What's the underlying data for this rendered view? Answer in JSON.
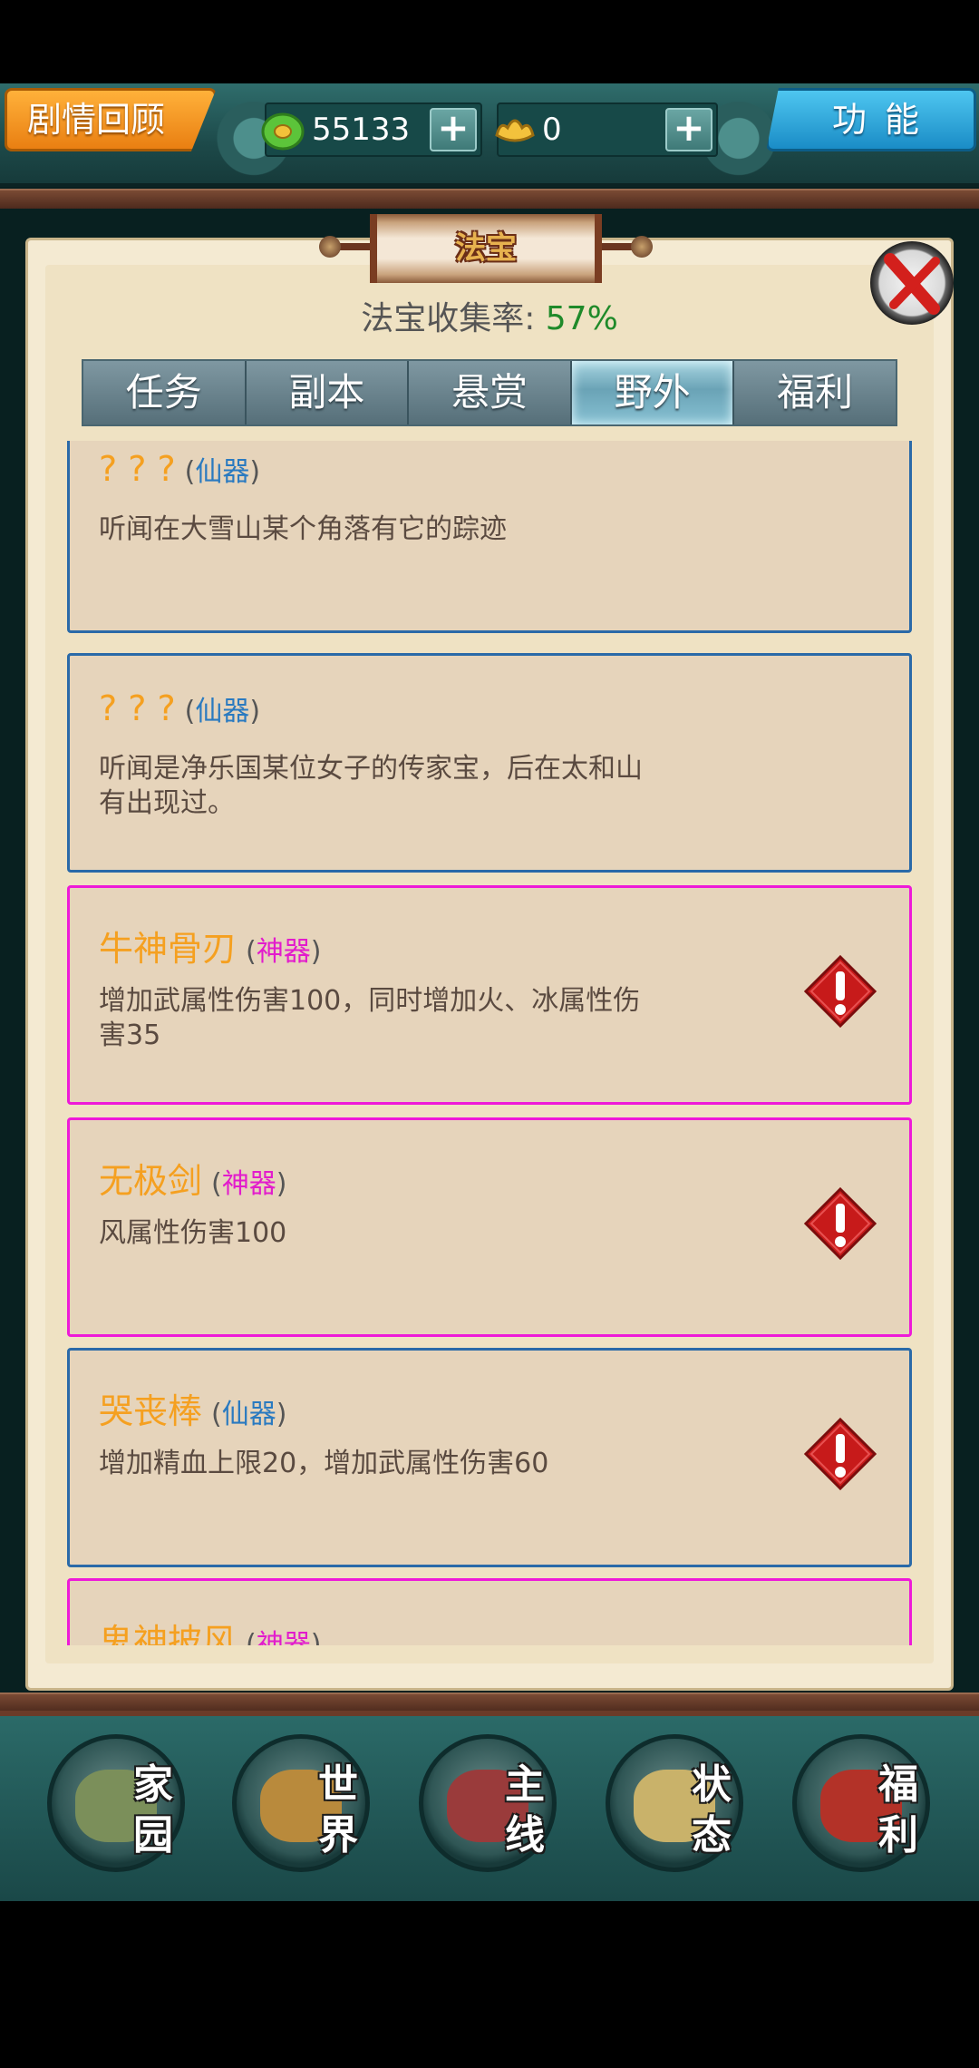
{
  "header": {
    "story_button": "剧情回顾",
    "jade_amount": "55133",
    "gold_amount": "0",
    "plus_label": "+",
    "function_button": "功能"
  },
  "panel": {
    "title": "法宝",
    "collect_label": "法宝收集率: ",
    "collect_value": "57%"
  },
  "tabs": [
    {
      "label": "任务"
    },
    {
      "label": "副本"
    },
    {
      "label": "悬赏"
    },
    {
      "label": "野外",
      "active": true
    },
    {
      "label": "福利"
    }
  ],
  "type_open": "(",
  "type_close": ")",
  "items": [
    {
      "name": "? ? ?",
      "type": "仙器",
      "desc": "听闻在大雪山某个角落有它的踪迹",
      "alert": false
    },
    {
      "name": "? ? ?",
      "type": "仙器",
      "desc": "听闻是净乐国某位女子的传家宝，后在太和山有出现过。",
      "alert": false
    },
    {
      "name": "牛神骨刃",
      "type": "神器",
      "desc": "增加武属性伤害100，同时增加火、冰属性伤害35",
      "alert": true
    },
    {
      "name": "无极剑",
      "type": "神器",
      "desc": "风属性伤害100",
      "alert": true
    },
    {
      "name": "哭丧棒",
      "type": "仙器",
      "desc": "增加精血上限20，增加武属性伤害60",
      "alert": true
    },
    {
      "name": "鬼神披风",
      "type": "神器",
      "desc": "",
      "alert": false
    }
  ],
  "nav": [
    {
      "l1": "家",
      "l2": "园",
      "color": "#7b8f5a"
    },
    {
      "l1": "世",
      "l2": "界",
      "color": "#b98a3c"
    },
    {
      "l1": "主",
      "l2": "线",
      "color": "#9a3b3b"
    },
    {
      "l1": "状",
      "l2": "态",
      "color": "#c9b26a"
    },
    {
      "l1": "福",
      "l2": "利",
      "color": "#b33228"
    }
  ],
  "colors": {
    "immortal_border": "#2a6aa8",
    "divine_border": "#ee1ad8",
    "item_name": "#f5a020",
    "collect_rate": "#1f8a2a"
  }
}
